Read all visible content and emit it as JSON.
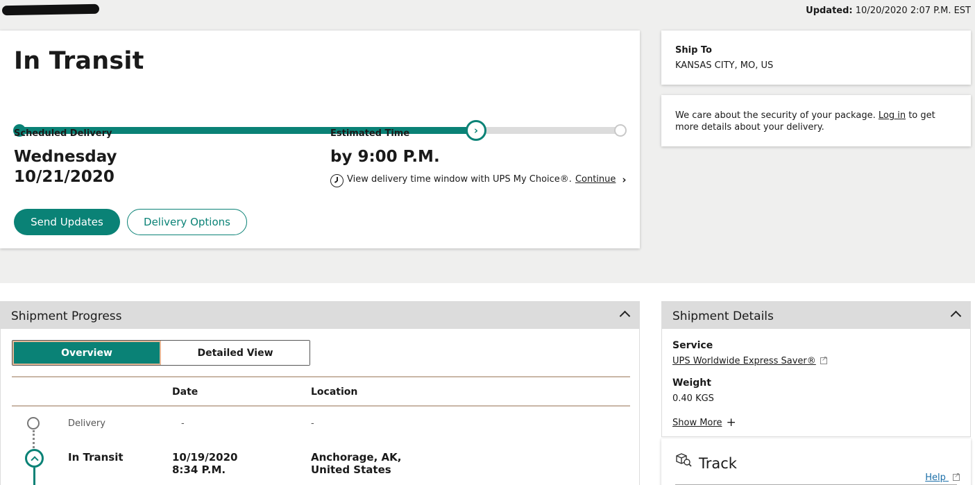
{
  "header": {
    "updated_label": "Updated:",
    "updated_value": "10/20/2020 2:07 P.M. EST"
  },
  "status": {
    "title": "In Transit",
    "progress": 0.76,
    "scheduled_label": "Scheduled Delivery",
    "scheduled_day": "Wednesday",
    "scheduled_date": "10/21/2020",
    "estimated_label": "Estimated Time",
    "estimated_value": "by 9:00 P.M.",
    "choice_text": "View delivery time window with UPS My Choice®.",
    "choice_link": "Continue",
    "send_updates": "Send Updates",
    "delivery_options": "Delivery Options"
  },
  "ship_to": {
    "label": "Ship To",
    "value": "KANSAS CITY, MO, US"
  },
  "security": {
    "text_before": "We care about the security of your package.",
    "link": "Log in",
    "text_after": "to get more details about your delivery."
  },
  "progress_panel": {
    "title": "Shipment Progress",
    "tabs": [
      "Overview",
      "Detailed View"
    ],
    "columns": {
      "date": "Date",
      "location": "Location"
    },
    "rows": [
      {
        "status": "Delivery",
        "date": "-",
        "time": "",
        "location": "-"
      },
      {
        "status": "In Transit",
        "date": "10/19/2020",
        "time": "8:34 P.M.",
        "location": "Anchorage, AK, United States"
      }
    ]
  },
  "details_panel": {
    "title": "Shipment Details",
    "service_label": "Service",
    "service_value": "UPS Worldwide Express Saver®",
    "weight_label": "Weight",
    "weight_value": "0.40 KGS",
    "show_more": "Show More"
  },
  "track": {
    "title": "Track",
    "help": "Help"
  },
  "colors": {
    "brand": "#0a8276",
    "panel_header": "#dcdcdc",
    "band": "#efefee"
  }
}
